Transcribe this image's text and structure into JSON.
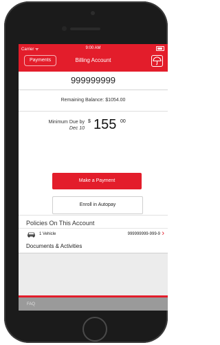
{
  "status_bar": {
    "carrier": "Carrier ᯤ",
    "time": "9:00 AM"
  },
  "nav": {
    "back_label": "Payments",
    "title": "Billing Account"
  },
  "account": {
    "number": "999999999"
  },
  "summary": {
    "balance_label": "Remaining Balance:",
    "balance_value": "$1054.00",
    "min_due_label": "Minimum Due by",
    "min_due_date": "Dec 10",
    "amount_symbol": "$",
    "amount_whole": "155",
    "amount_cents": "00"
  },
  "actions": {
    "make_payment": "Make a Payment",
    "enroll_autopay": "Enroll in Autopay"
  },
  "policies": {
    "title": "Policies On This Account",
    "items": [
      {
        "label": "1 Vehicle",
        "number": "999999999-999-9"
      }
    ]
  },
  "documents": {
    "title": "Documents & Activities"
  },
  "footer": {
    "faq": "FAQ"
  },
  "colors": {
    "accent": "#e31d2b"
  }
}
